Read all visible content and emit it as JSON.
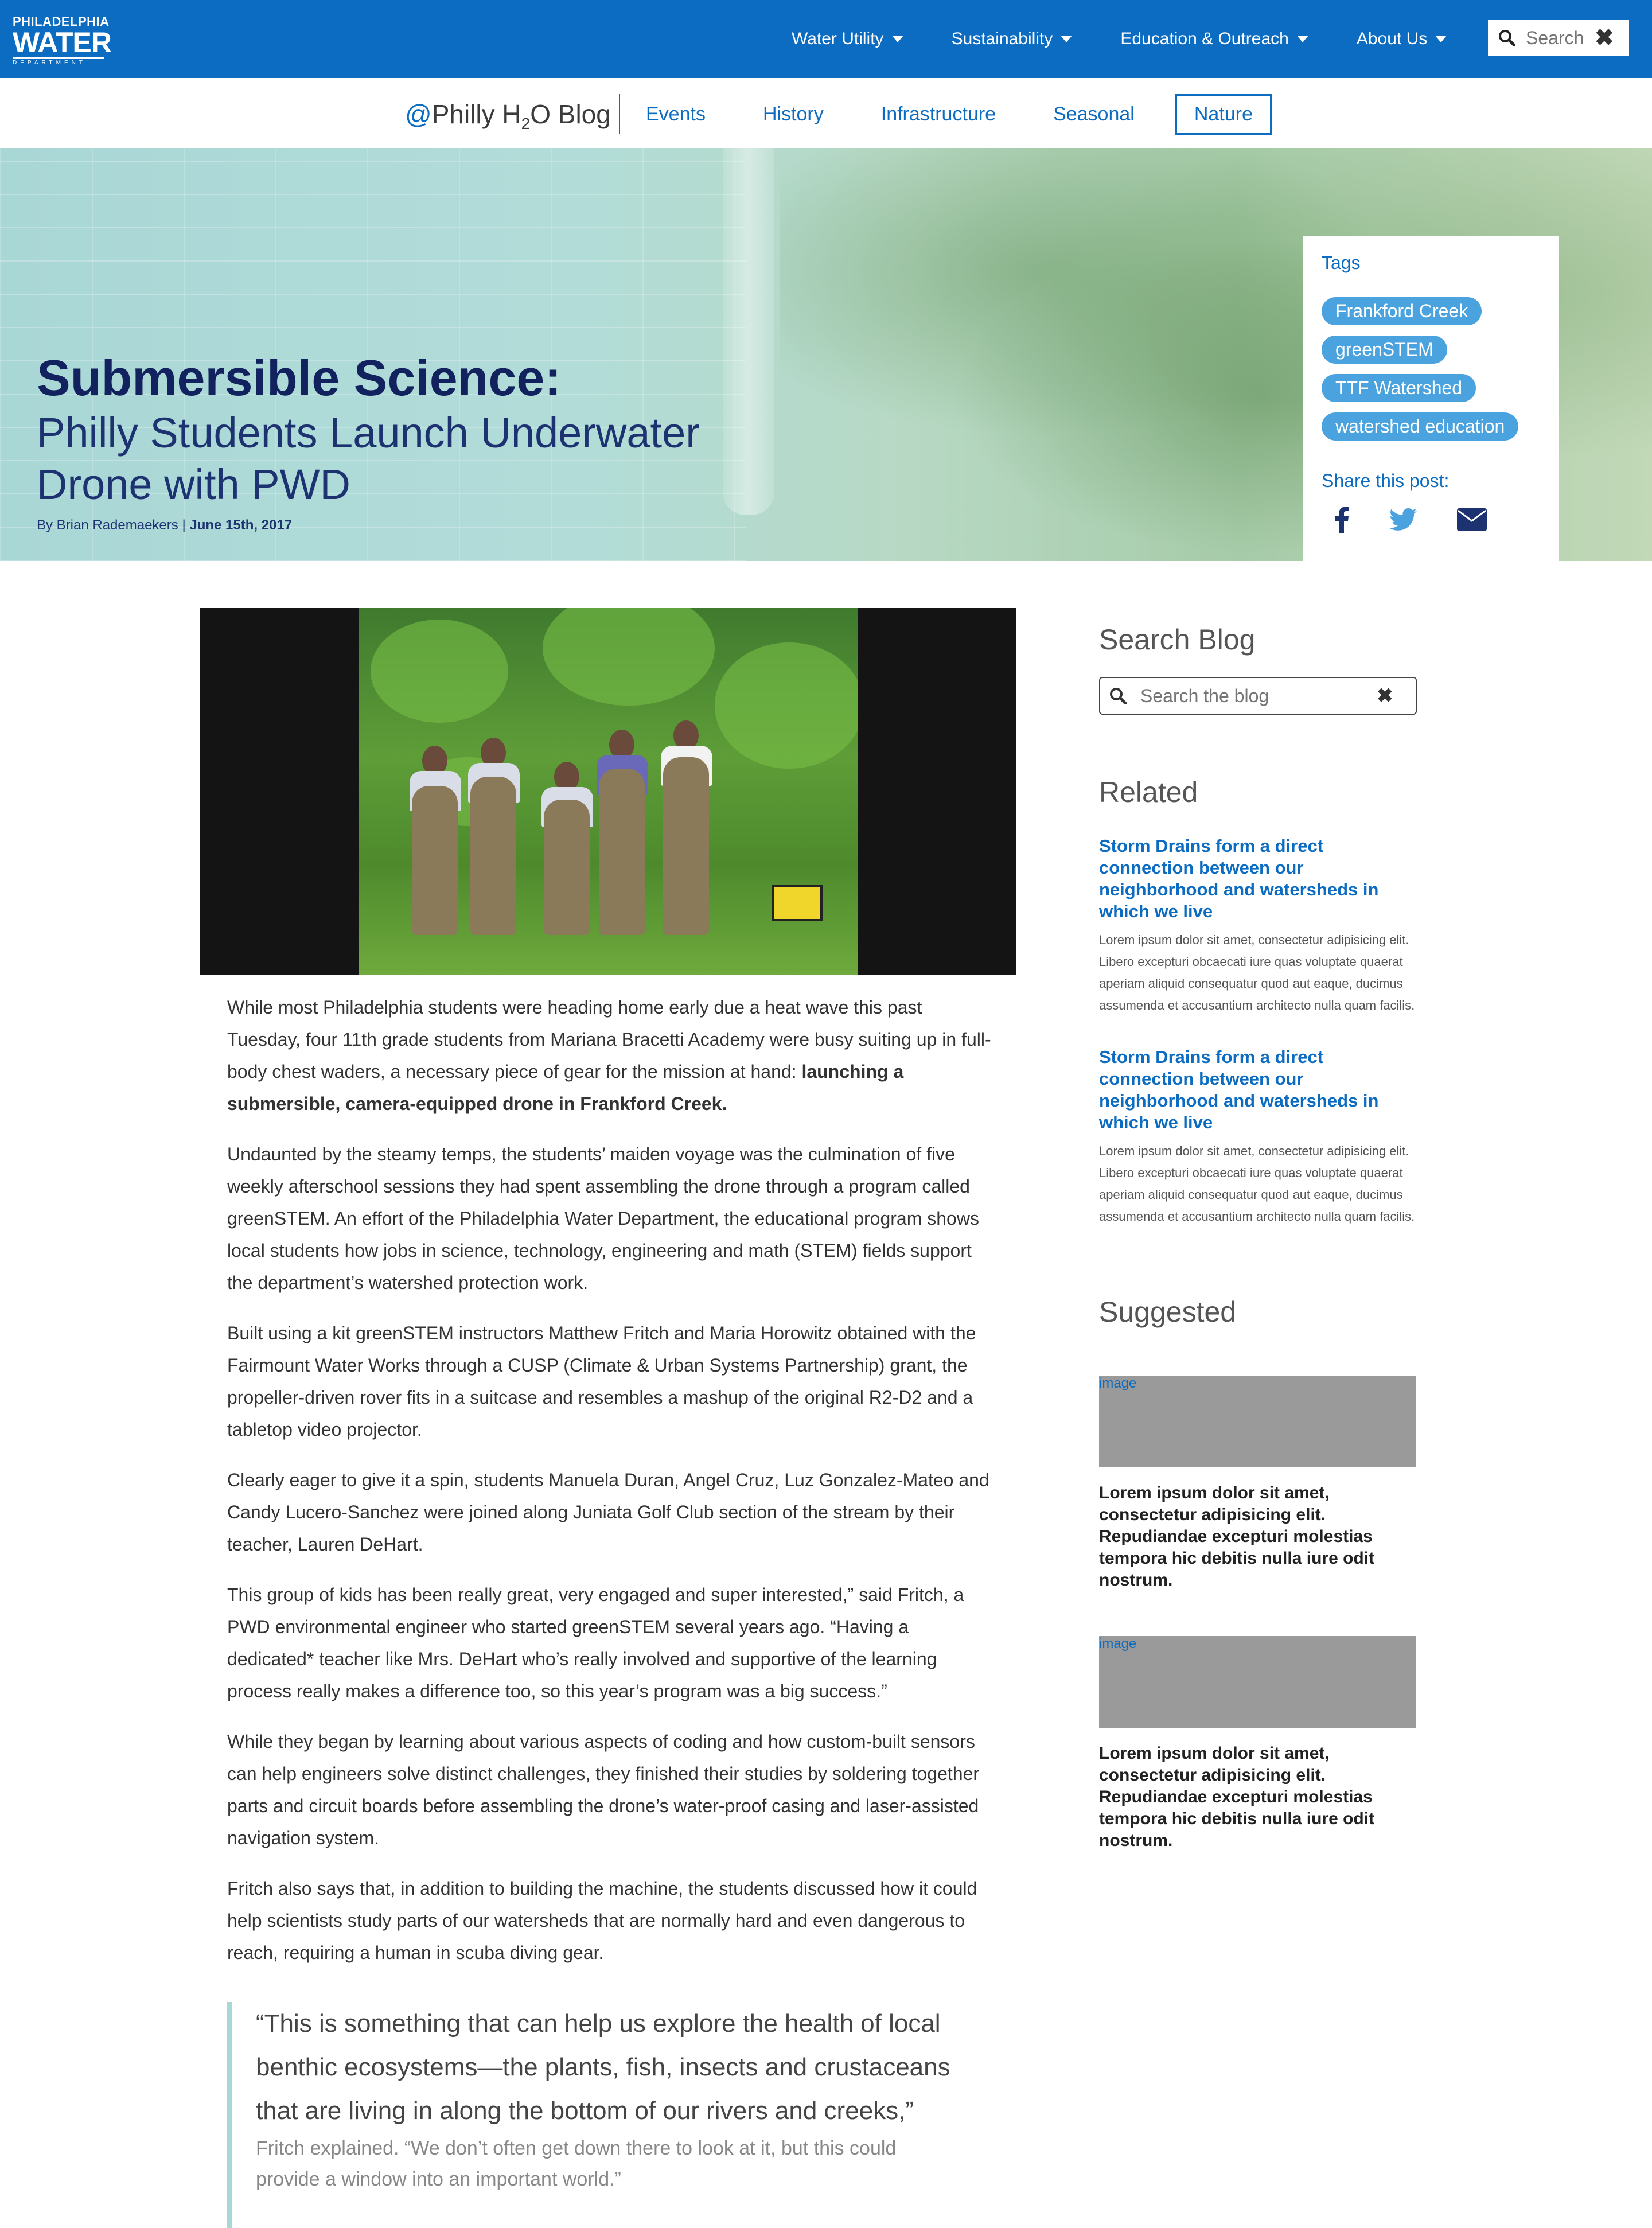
{
  "topbar": {
    "logo": {
      "line1": "PHILADELPHIA",
      "line2": "WATER",
      "line3": "DEPARTMENT"
    },
    "nav": [
      {
        "label": "Water Utility"
      },
      {
        "label": "Sustainability"
      },
      {
        "label": "Education & Outreach"
      },
      {
        "label": "About Us"
      }
    ],
    "search": {
      "placeholder": "Search"
    }
  },
  "subnav": {
    "blog_at": "@",
    "blog_pre": "Philly H",
    "blog_sub": "2",
    "blog_post": "O Blog",
    "tabs": [
      {
        "label": "Events"
      },
      {
        "label": "History"
      },
      {
        "label": "Infrastructure"
      },
      {
        "label": "Seasonal"
      },
      {
        "label": "Nature"
      }
    ]
  },
  "hero": {
    "title_bold": "Submersible Science:",
    "title_rest": "Philly Students Launch Underwater Drone with PWD",
    "byline_author": "By Brian Rademaekers | ",
    "byline_date": "June 15th, 2017",
    "tags_label": "Tags",
    "tags": [
      "Frankford Creek",
      "greenSTEM",
      "TTF Watershed",
      "watershed education"
    ],
    "share_label": "Share this post:"
  },
  "article": {
    "p1_a": "While most Philadelphia students were heading home early due a heat wave this past Tuesday, four 11th grade students from Mariana Bracetti Academy were busy suiting up in full-body chest waders, a necessary piece of gear for the mission at hand: ",
    "p1_b": "launching a submersible, camera-equipped drone in Frankford Creek.",
    "p2": "Undaunted by the steamy temps, the students’ maiden voyage was the culmination of five weekly afterschool sessions they had spent assembling the drone through a program called greenSTEM. An effort of the Philadelphia Water Department, the educational program shows local students how jobs in science, technology, engineering and math (STEM) fields support the department’s watershed protection work.",
    "p3": "Built using a kit greenSTEM instructors Matthew Fritch and Maria Horowitz obtained with the Fairmount Water Works through a CUSP (Climate & Urban Systems Partnership) grant, the propeller-driven rover fits in a suitcase and resembles a mashup of the original R2-D2 and a tabletop video projector.",
    "p4": "Clearly eager to give it a spin, students Manuela Duran, Angel Cruz, Luz Gonzalez-Mateo and Candy Lucero-Sanchez were joined along Juniata Golf Club section of the stream by their teacher, Lauren DeHart.",
    "p5": "This group of kids has been really great, very engaged and super interested,” said Fritch, a PWD environmental engineer who started greenSTEM several years ago. “Having a dedicated* teacher like Mrs. DeHart who’s really involved and supportive of the learning process really makes a difference too, so this year’s program was a big success.”",
    "p6": "While they began by learning about various aspects of coding and how custom-built sensors can help engineers solve distinct challenges, they finished their studies by soldering together parts and circuit boards before assembling the drone’s water-proof casing and laser-assisted navigation system.",
    "p7": "Fritch also says that, in addition to building the machine, the students discussed how it could help scientists study parts of our watersheds that are normally hard and even dangerous to reach, requiring a human in scuba diving gear.",
    "quote_big": "“This is something that can help us explore the health of local benthic ecosystems—the plants, fish, insects and crustaceans that are living in along the bottom of our rivers and creeks,”",
    "quote_small": "Fritch explained. “We don’t often get down there to look at it, but this could provide a window into an important world.”"
  },
  "sidebar": {
    "search_heading": "Search Blog",
    "search_placeholder": "Search the blog",
    "related_heading": "Related",
    "related": [
      {
        "title": "Storm Drains form a direct connection between our neighborhood and watersheds in which we live",
        "body": "Lorem ipsum dolor sit amet, consectetur adipisicing elit. Libero excepturi obcaecati iure quas voluptate quaerat aperiam aliquid consequatur quod aut eaque, ducimus assumenda et accusantium architecto nulla quam facilis."
      },
      {
        "title": "Storm Drains form a direct connection between our neighborhood and watersheds in which we live",
        "body": "Lorem ipsum dolor sit amet, consectetur adipisicing elit. Libero excepturi obcaecati iure quas voluptate quaerat aperiam aliquid consequatur quod aut eaque, ducimus assumenda et accusantium architecto nulla quam facilis."
      }
    ],
    "suggested_heading": "Suggested",
    "suggested": [
      {
        "img_alt": "image",
        "title": "Lorem ipsum dolor sit amet, consectetur adipisicing elit. Repudiandae excepturi molestias tempora hic debitis nulla iure odit nostrum."
      },
      {
        "img_alt": "image",
        "title": "Lorem ipsum dolor sit amet, consectetur adipisicing elit. Repudiandae excepturi molestias tempora hic debitis nulla iure odit nostrum."
      }
    ]
  },
  "icons": {
    "search": "search-icon",
    "close": "close-icon",
    "facebook": "facebook-icon",
    "twitter": "twitter-icon",
    "email": "email-icon"
  },
  "colors": {
    "brand_blue": "#0c6cc1",
    "navy": "#11225e",
    "tag_blue": "#4aa3df",
    "hero_teal": "#a9d7d6"
  }
}
